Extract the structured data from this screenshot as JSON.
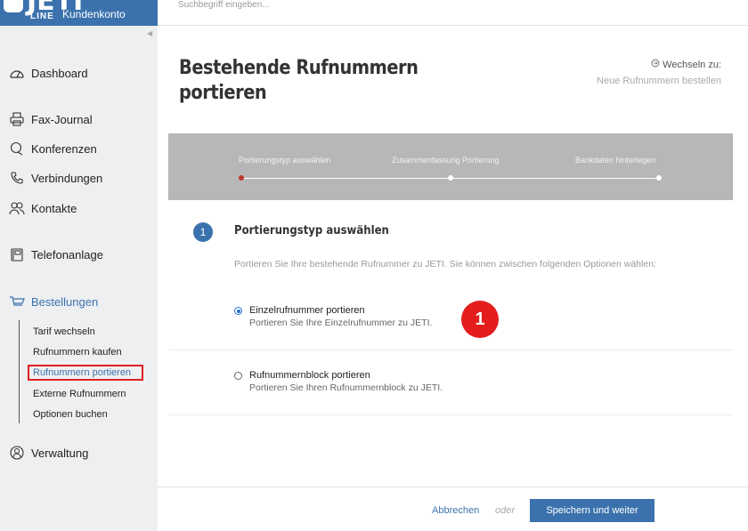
{
  "header": {
    "brand_sub": "Kundenkonto",
    "logo_text": "JETI",
    "logo_sub": "LINE",
    "search_placeholder": "Suchbegriff eingeben..."
  },
  "sidebar": {
    "items": [
      {
        "label": "Dashboard",
        "icon": "dashboard-icon"
      },
      {
        "label": "Fax-Journal",
        "icon": "fax-icon"
      },
      {
        "label": "Konferenzen",
        "icon": "conference-icon"
      },
      {
        "label": "Verbindungen",
        "icon": "phone-icon"
      },
      {
        "label": "Kontakte",
        "icon": "contacts-icon"
      },
      {
        "label": "Telefonanlage",
        "icon": "pbx-icon"
      },
      {
        "label": "Bestellungen",
        "icon": "cart-icon"
      },
      {
        "label": "Verwaltung",
        "icon": "user-icon"
      }
    ],
    "sub_items": [
      {
        "label": "Tarif wechseln"
      },
      {
        "label": "Rufnummern kaufen"
      },
      {
        "label": "Rufnummern portieren"
      },
      {
        "label": "Externe Rufnummern"
      },
      {
        "label": "Optionen buchen"
      }
    ]
  },
  "main": {
    "title": "Bestehende Rufnummern portieren",
    "switch_label": "Wechseln zu:",
    "switch_link": "Neue Rufnummern bestellen",
    "steps": [
      {
        "label": "Portierungstyp auswählen"
      },
      {
        "label": "Zusammenfassung Portierung"
      },
      {
        "label": "Bankdaten hinterlegen"
      }
    ],
    "section_number": "1",
    "section_title": "Portierungstyp auswählen",
    "section_desc": "Portieren Sie Ihre bestehende Rufnummer zu JETI. Sie können zwischen folgenden Optionen wählen:",
    "options": [
      {
        "title": "Einzelrufnummer portieren",
        "desc": "Portieren Sie Ihre Einzelrufnummer zu JETI.",
        "selected": true
      },
      {
        "title": "Rufnummernblock portieren",
        "desc": "Portieren Sie Ihren Rufnummernblock zu JETI.",
        "selected": false
      }
    ],
    "annotation_badge": "1"
  },
  "footer": {
    "cancel": "Abbrechen",
    "or": "oder",
    "save": "Speichern und weiter"
  },
  "colors": {
    "brand": "#3b72ad",
    "sidebar_bg": "#eeeff1",
    "stepper_bg": "#b7b7b7",
    "current_step_dot": "#c0392b",
    "annotation_red": "#e41d1d"
  }
}
